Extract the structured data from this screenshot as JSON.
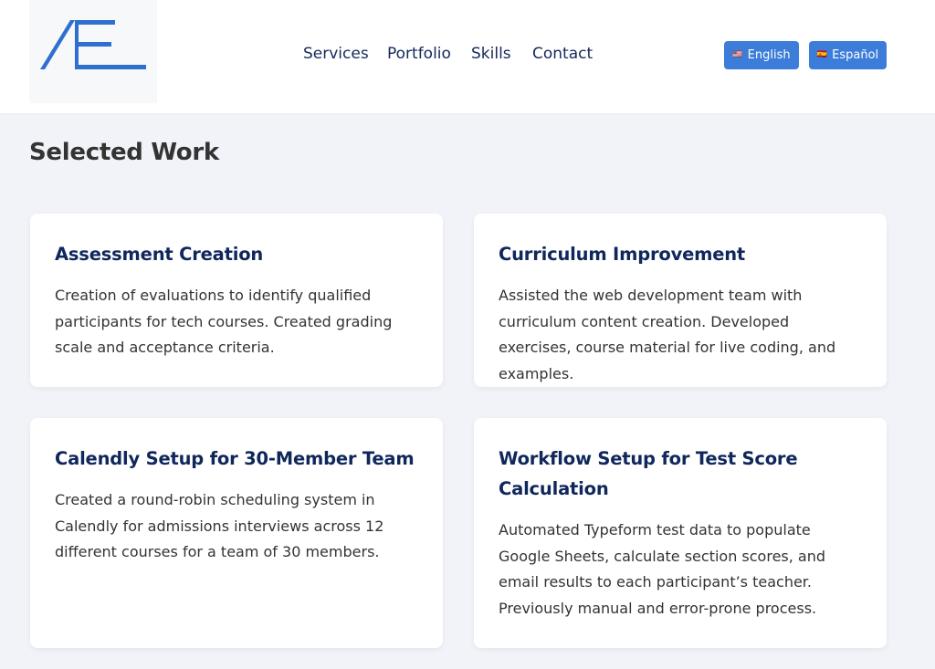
{
  "header": {
    "logo_text": "AE",
    "nav": [
      "Services",
      "Portfolio",
      "Skills",
      "Contact"
    ],
    "languages": [
      {
        "flag": "🇺🇸",
        "label": "English"
      },
      {
        "flag": "🇪🇸",
        "label": "Español"
      }
    ],
    "colors": {
      "accent": "#3b7dd8",
      "nav_text": "#14295a",
      "logo": "#2f6fcf"
    }
  },
  "main": {
    "section_title": "Selected Work",
    "cards": [
      {
        "title": "Assessment Creation",
        "description": "Creation of evaluations to identify qualified participants for tech courses. Created grading scale and acceptance criteria."
      },
      {
        "title": "Curriculum Improvement",
        "description": "Assisted the web development team with curriculum content creation. Developed exercises, course material for live coding, and examples."
      },
      {
        "title": "Calendly Setup for 30-Member Team",
        "description": "Created a round-robin scheduling system in Calendly for admissions interviews across 12 different courses for a team of 30 members."
      },
      {
        "title": "Workflow Setup for Test Score Calculation",
        "description": "Automated Typeform test data to populate Google Sheets, calculate section scores, and email results to each participant’s teacher. Previously manual and error-prone process."
      }
    ]
  }
}
